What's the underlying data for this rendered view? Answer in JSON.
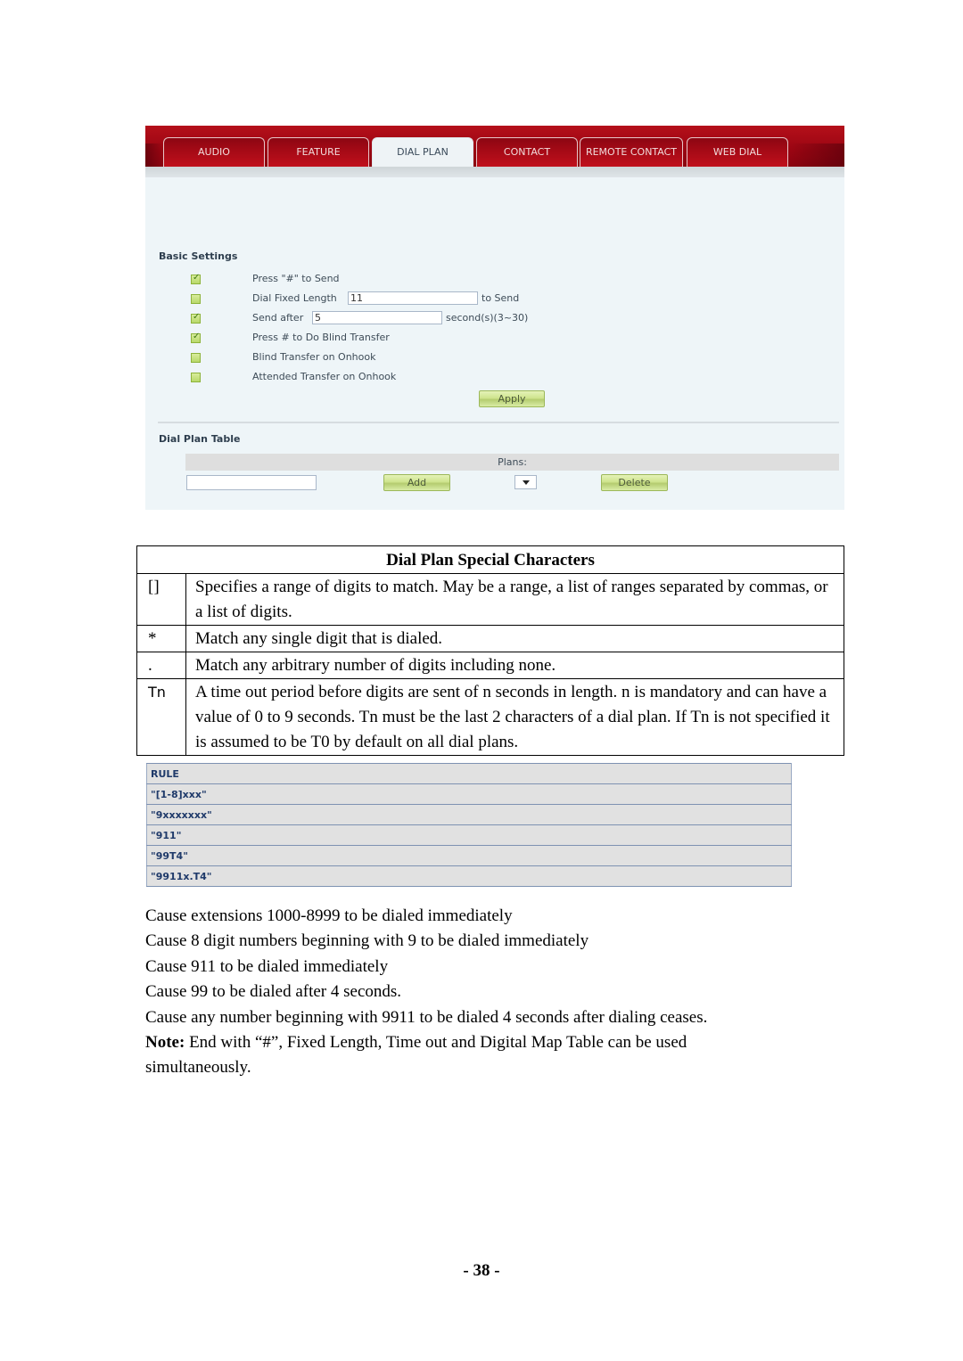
{
  "ui_screenshot": {
    "tabs": [
      {
        "label": "AUDIO",
        "active": false
      },
      {
        "label": "FEATURE",
        "active": false
      },
      {
        "label": "DIAL PLAN",
        "active": true
      },
      {
        "label": "CONTACT",
        "active": false
      },
      {
        "label": "REMOTE CONTACT",
        "active": false
      },
      {
        "label": "WEB DIAL",
        "active": false
      }
    ],
    "basic_settings": {
      "title": "Basic Settings",
      "items": [
        {
          "label": "Press \"#\" to Send",
          "checked": true
        },
        {
          "label": "Dial Fixed Length",
          "checked": false,
          "value": "11",
          "suffix": "to Send"
        },
        {
          "label": "Send after",
          "checked": true,
          "value": "5",
          "suffix": "second(s)(3~30)"
        },
        {
          "label": "Press # to Do Blind Transfer",
          "checked": true
        },
        {
          "label": "Blind Transfer on Onhook",
          "checked": false
        },
        {
          "label": "Attended Transfer on Onhook",
          "checked": false
        }
      ],
      "apply_label": "Apply"
    },
    "dial_plan_table": {
      "title": "Dial Plan Table",
      "plans_header": "Plans:",
      "input_value": "",
      "add_label": "Add",
      "select_value": "",
      "delete_label": "Delete"
    }
  },
  "special_characters": {
    "title": "Dial Plan Special Characters",
    "rows": [
      {
        "symbol": "[]",
        "description": "Specifies a range of digits to match. May be a range, a list of ranges separated by commas, or a list of digits."
      },
      {
        "symbol": "*",
        "description": "Match any single digit that is dialed."
      },
      {
        "symbol": ".",
        "description": "Match any arbitrary number of digits including none."
      },
      {
        "symbol": "Tn",
        "description": "A time out period before digits are sent of n seconds in length. n is mandatory and can have a value of 0 to 9 seconds. Tn must be the last 2 characters of a dial plan. If Tn is not specified it is assumed to be T0 by default on all dial plans."
      }
    ]
  },
  "rule_table": {
    "header": "RULE",
    "rules": [
      "\"[1-8]xxx\"",
      "\"9xxxxxxx\"",
      "\"911\"",
      "\"99T4\"",
      "\"9911x.T4\""
    ]
  },
  "explanations": [
    "Cause extensions 1000-8999 to be dialed immediately",
    "Cause 8 digit numbers beginning with 9 to be dialed immediately",
    "Cause 911 to be dialed immediately",
    "Cause 99 to be dialed after 4 seconds.",
    "Cause any number beginning with 9911 to be dialed 4 seconds after dialing ceases."
  ],
  "note": {
    "label": "Note:",
    "text": " End with “#”, Fixed Length, Time out and Digital Map Table can be used",
    "continuation": "simultaneously."
  },
  "page_number": "- 38 -"
}
